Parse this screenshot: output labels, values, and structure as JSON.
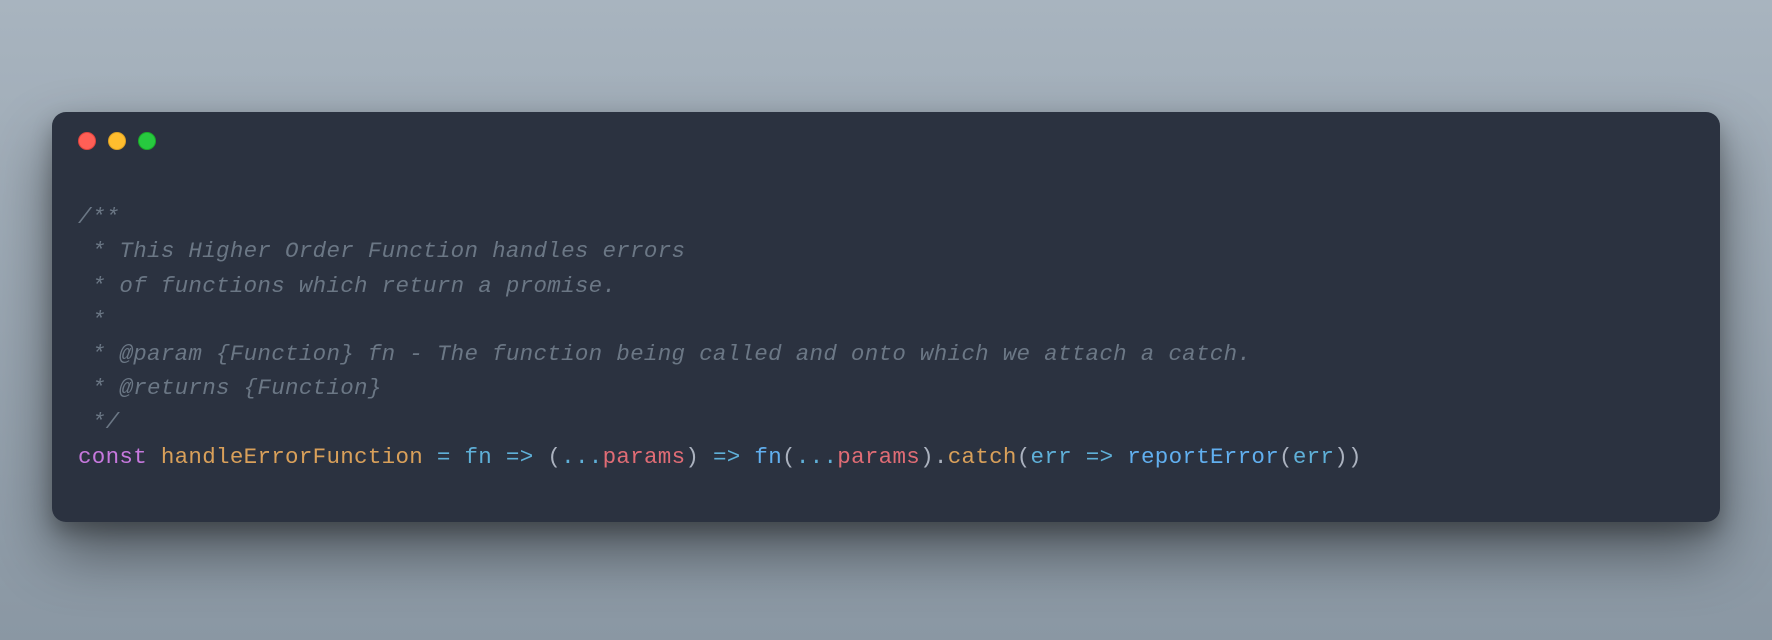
{
  "comment": {
    "line1": "/**",
    "line2": " * This Higher Order Function handles errors",
    "line3": " * of functions which return a promise.",
    "line4": " *",
    "line5": " * @param {Function} fn - The function being called and onto which we attach a catch.",
    "line6": " * @returns {Function}",
    "line7": " */"
  },
  "code": {
    "const": "const",
    "functionName": "handleErrorFunction",
    "eq1": " = ",
    "fn1": "fn",
    "arrow1": " => ",
    "openParen1": "(",
    "spread1": "...",
    "params1": "params",
    "closeParen1": ")",
    "arrow2": " => ",
    "fn2": "fn",
    "openParen2": "(",
    "spread2": "...",
    "params2": "params",
    "closeParen2": ")",
    "dot1": ".",
    "catch": "catch",
    "openParen3": "(",
    "err1": "err",
    "arrow3": " => ",
    "reportError": "reportError",
    "openParen4": "(",
    "err2": "err",
    "closeParen4": "))"
  }
}
